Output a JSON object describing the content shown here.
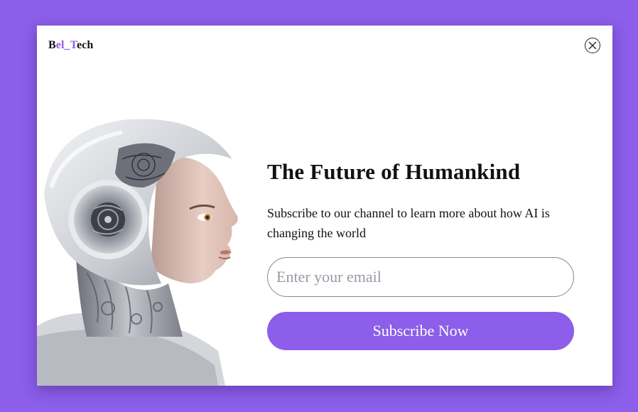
{
  "brand": {
    "logo_prefix": "B",
    "logo_accent": "el_T",
    "logo_suffix": "ech"
  },
  "close": {
    "icon": "close-icon"
  },
  "hero": {
    "image": "robot-woman-profile-illustration"
  },
  "content": {
    "title": "The Future of Humankind",
    "subtitle": "Subscribe to our channel to learn more about how AI is changing the world"
  },
  "form": {
    "email_placeholder": "Enter your email",
    "email_value": "",
    "submit_label": "Subscribe Now"
  },
  "colors": {
    "accent": "#8c5ee9",
    "background": "#8c5ee9",
    "card": "#ffffff"
  }
}
